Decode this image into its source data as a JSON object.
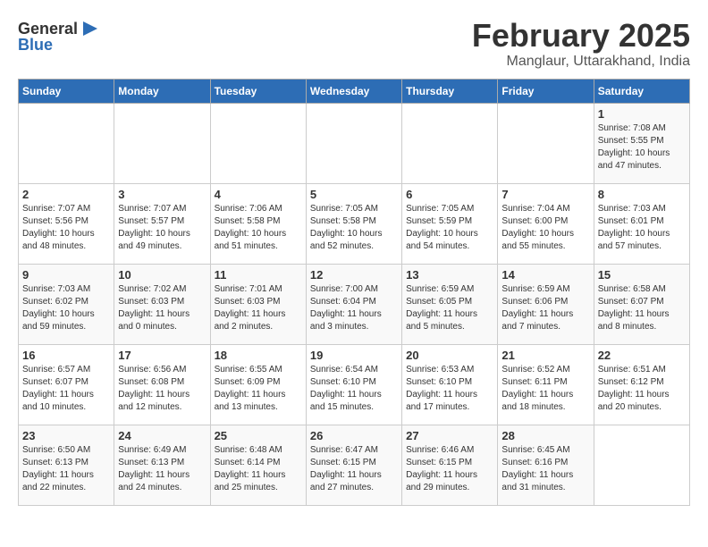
{
  "logo": {
    "general": "General",
    "blue": "Blue"
  },
  "title": {
    "month": "February 2025",
    "location": "Manglaur, Uttarakhand, India"
  },
  "days_of_week": [
    "Sunday",
    "Monday",
    "Tuesday",
    "Wednesday",
    "Thursday",
    "Friday",
    "Saturday"
  ],
  "weeks": [
    [
      {
        "day": "",
        "info": ""
      },
      {
        "day": "",
        "info": ""
      },
      {
        "day": "",
        "info": ""
      },
      {
        "day": "",
        "info": ""
      },
      {
        "day": "",
        "info": ""
      },
      {
        "day": "",
        "info": ""
      },
      {
        "day": "1",
        "info": "Sunrise: 7:08 AM\nSunset: 5:55 PM\nDaylight: 10 hours and 47 minutes."
      }
    ],
    [
      {
        "day": "2",
        "info": "Sunrise: 7:07 AM\nSunset: 5:56 PM\nDaylight: 10 hours and 48 minutes."
      },
      {
        "day": "3",
        "info": "Sunrise: 7:07 AM\nSunset: 5:57 PM\nDaylight: 10 hours and 49 minutes."
      },
      {
        "day": "4",
        "info": "Sunrise: 7:06 AM\nSunset: 5:58 PM\nDaylight: 10 hours and 51 minutes."
      },
      {
        "day": "5",
        "info": "Sunrise: 7:05 AM\nSunset: 5:58 PM\nDaylight: 10 hours and 52 minutes."
      },
      {
        "day": "6",
        "info": "Sunrise: 7:05 AM\nSunset: 5:59 PM\nDaylight: 10 hours and 54 minutes."
      },
      {
        "day": "7",
        "info": "Sunrise: 7:04 AM\nSunset: 6:00 PM\nDaylight: 10 hours and 55 minutes."
      },
      {
        "day": "8",
        "info": "Sunrise: 7:03 AM\nSunset: 6:01 PM\nDaylight: 10 hours and 57 minutes."
      }
    ],
    [
      {
        "day": "9",
        "info": "Sunrise: 7:03 AM\nSunset: 6:02 PM\nDaylight: 10 hours and 59 minutes."
      },
      {
        "day": "10",
        "info": "Sunrise: 7:02 AM\nSunset: 6:03 PM\nDaylight: 11 hours and 0 minutes."
      },
      {
        "day": "11",
        "info": "Sunrise: 7:01 AM\nSunset: 6:03 PM\nDaylight: 11 hours and 2 minutes."
      },
      {
        "day": "12",
        "info": "Sunrise: 7:00 AM\nSunset: 6:04 PM\nDaylight: 11 hours and 3 minutes."
      },
      {
        "day": "13",
        "info": "Sunrise: 6:59 AM\nSunset: 6:05 PM\nDaylight: 11 hours and 5 minutes."
      },
      {
        "day": "14",
        "info": "Sunrise: 6:59 AM\nSunset: 6:06 PM\nDaylight: 11 hours and 7 minutes."
      },
      {
        "day": "15",
        "info": "Sunrise: 6:58 AM\nSunset: 6:07 PM\nDaylight: 11 hours and 8 minutes."
      }
    ],
    [
      {
        "day": "16",
        "info": "Sunrise: 6:57 AM\nSunset: 6:07 PM\nDaylight: 11 hours and 10 minutes."
      },
      {
        "day": "17",
        "info": "Sunrise: 6:56 AM\nSunset: 6:08 PM\nDaylight: 11 hours and 12 minutes."
      },
      {
        "day": "18",
        "info": "Sunrise: 6:55 AM\nSunset: 6:09 PM\nDaylight: 11 hours and 13 minutes."
      },
      {
        "day": "19",
        "info": "Sunrise: 6:54 AM\nSunset: 6:10 PM\nDaylight: 11 hours and 15 minutes."
      },
      {
        "day": "20",
        "info": "Sunrise: 6:53 AM\nSunset: 6:10 PM\nDaylight: 11 hours and 17 minutes."
      },
      {
        "day": "21",
        "info": "Sunrise: 6:52 AM\nSunset: 6:11 PM\nDaylight: 11 hours and 18 minutes."
      },
      {
        "day": "22",
        "info": "Sunrise: 6:51 AM\nSunset: 6:12 PM\nDaylight: 11 hours and 20 minutes."
      }
    ],
    [
      {
        "day": "23",
        "info": "Sunrise: 6:50 AM\nSunset: 6:13 PM\nDaylight: 11 hours and 22 minutes."
      },
      {
        "day": "24",
        "info": "Sunrise: 6:49 AM\nSunset: 6:13 PM\nDaylight: 11 hours and 24 minutes."
      },
      {
        "day": "25",
        "info": "Sunrise: 6:48 AM\nSunset: 6:14 PM\nDaylight: 11 hours and 25 minutes."
      },
      {
        "day": "26",
        "info": "Sunrise: 6:47 AM\nSunset: 6:15 PM\nDaylight: 11 hours and 27 minutes."
      },
      {
        "day": "27",
        "info": "Sunrise: 6:46 AM\nSunset: 6:15 PM\nDaylight: 11 hours and 29 minutes."
      },
      {
        "day": "28",
        "info": "Sunrise: 6:45 AM\nSunset: 6:16 PM\nDaylight: 11 hours and 31 minutes."
      },
      {
        "day": "",
        "info": ""
      }
    ]
  ]
}
